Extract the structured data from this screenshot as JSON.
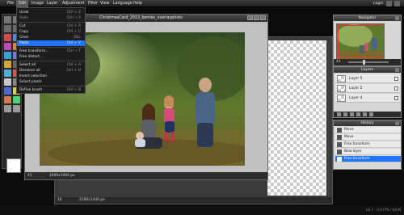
{
  "menubar": {
    "items": [
      "File",
      "Edit",
      "Image",
      "Layer",
      "Adjustment",
      "Filter",
      "View",
      "Language",
      "Help"
    ],
    "login": "Login"
  },
  "edit_menu": {
    "items": [
      {
        "label": "Undo",
        "shortcut": "Ctrl + Z",
        "state": "normal"
      },
      {
        "label": "Redo",
        "shortcut": "Ctrl + Y",
        "state": "dim"
      },
      {
        "label": "Cut",
        "shortcut": "Ctrl + X",
        "state": "normal"
      },
      {
        "label": "Copy",
        "shortcut": "Ctrl + C",
        "state": "normal"
      },
      {
        "label": "Clear",
        "shortcut": "DEL",
        "state": "normal"
      },
      {
        "label": "Paste",
        "shortcut": "Ctrl + V",
        "state": "highlighted"
      },
      {
        "label": "Free transform...",
        "shortcut": "Ctrl + T",
        "state": "normal"
      },
      {
        "label": "Free distort...",
        "shortcut": "",
        "state": "normal"
      },
      {
        "label": "Select all",
        "shortcut": "Ctrl + A",
        "state": "normal"
      },
      {
        "label": "Deselect all",
        "shortcut": "Ctrl + D",
        "state": "normal"
      },
      {
        "label": "Invert selection",
        "shortcut": "",
        "state": "normal"
      },
      {
        "label": "Select pixels",
        "shortcut": "",
        "state": "normal"
      },
      {
        "label": "Define brush",
        "shortcut": "Ctrl + B",
        "state": "normal"
      }
    ]
  },
  "main_window": {
    "title": "ChristmasCard_2013_berries_overlayphoto",
    "zoom": "43",
    "size": "1600x1066 px"
  },
  "back_window": {
    "zoom": "16",
    "size": "2160x1440 px"
  },
  "navigator": {
    "title": "Navigator",
    "zoom": "43"
  },
  "layers": {
    "title": "Layers",
    "items": [
      "Layer 5",
      "Layer 5",
      "Layer 4"
    ]
  },
  "history": {
    "title": "History",
    "items": [
      {
        "label": "Move",
        "highlighted": false
      },
      {
        "label": "Move",
        "highlighted": false
      },
      {
        "label": "Free transform",
        "highlighted": false
      },
      {
        "label": "New layer",
        "highlighted": false
      },
      {
        "label": "Free transform",
        "highlighted": true
      }
    ]
  },
  "credit": "LB.7 · 0.0 FPS / 64 M"
}
